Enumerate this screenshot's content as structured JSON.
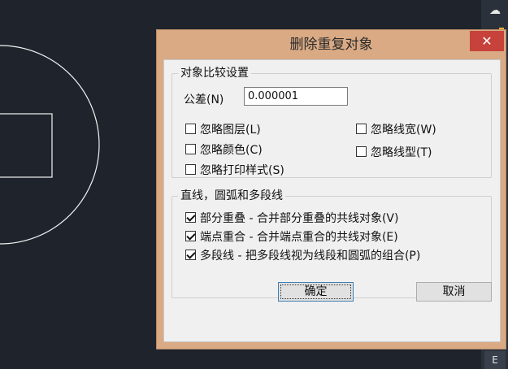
{
  "dialog": {
    "title": "删除重复对象",
    "close_label": "✕"
  },
  "settings_group": {
    "label": "对象比较设置",
    "tolerance_label": "公差(N)",
    "tolerance_value": "0.000001",
    "ignore_layer": {
      "label": "忽略图层(L)",
      "checked": false
    },
    "ignore_color": {
      "label": "忽略颜色(C)",
      "checked": false
    },
    "ignore_plotstyle": {
      "label": "忽略打印样式(S)",
      "checked": false
    },
    "ignore_lineweight": {
      "label": "忽略线宽(W)",
      "checked": false
    },
    "ignore_linetype": {
      "label": "忽略线型(T)",
      "checked": false
    }
  },
  "lines_group": {
    "label": "直线，圆弧和多段线",
    "overlap": {
      "label": "部分重叠 - 合并部分重叠的共线对象(V)",
      "checked": true
    },
    "endpoint": {
      "label": "端点重合 - 合并端点重合的共线对象(E)",
      "checked": true
    },
    "polyline": {
      "label": "多段线 - 把多段线视为线段和圆弧的组合(P)",
      "checked": true
    }
  },
  "buttons": {
    "ok": "确定",
    "cancel": "取消"
  },
  "side_panel": {
    "bottom_label": "E"
  }
}
